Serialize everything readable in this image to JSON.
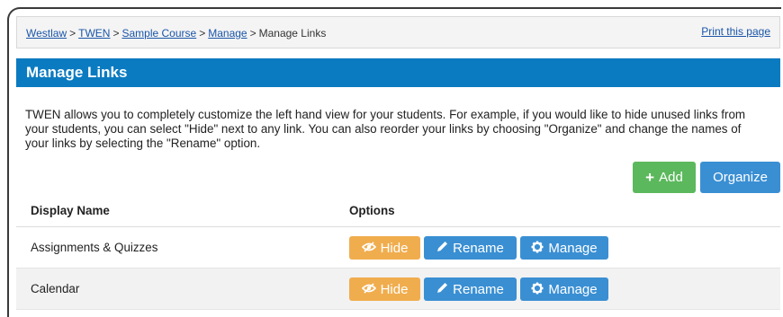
{
  "breadcrumb": {
    "items": [
      "Westlaw",
      "TWEN",
      "Sample Course",
      "Manage"
    ],
    "separator": ">",
    "current": "Manage Links"
  },
  "print_link": "Print this page",
  "section": {
    "title": "Manage Links"
  },
  "intro_text": "TWEN allows you to completely customize the left hand view for your students. For example, if you would like to hide unused links from your students, you can select \"Hide\" next to any link. You can also reorder your links by choosing \"Organize\" and change the names of your links by selecting the \"Rename\" option.",
  "toolbar": {
    "add_label": "Add",
    "add_icon": "+",
    "organize_label": "Organize"
  },
  "table": {
    "headers": [
      "Display Name",
      "Options"
    ],
    "rows": [
      {
        "name": "Assignments & Quizzes",
        "hide": "Hide",
        "rename": "Rename",
        "manage": "Manage"
      },
      {
        "name": "Calendar",
        "hide": "Hide",
        "rename": "Rename",
        "manage": "Manage"
      }
    ]
  },
  "colors": {
    "header_blue": "#0b7bc1",
    "button_blue": "#3a8fd3",
    "button_green": "#5cb85c",
    "button_orange": "#f0ad4e",
    "link_blue": "#1a55a8"
  },
  "icons": {
    "hide": "eye-slash-icon",
    "rename": "pencil-icon",
    "manage": "gear-icon",
    "add": "plus-icon"
  }
}
